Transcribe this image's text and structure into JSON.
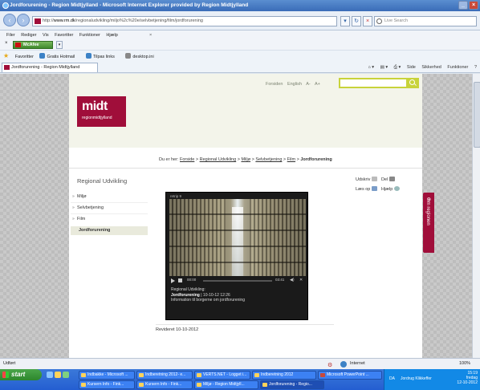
{
  "window": {
    "title": "Jordforurening - Region Midtjylland - Microsoft Internet Explorer provided by Region Midtjylland"
  },
  "addressbar": {
    "url_prefix": "http://",
    "url_domain": "www.rm.dk",
    "url_path": "/regionaludvikling/miljo%2c%20e/selvbetjening/film/jordforurening",
    "search_placeholder": "Live Search"
  },
  "menubar": {
    "items": [
      "Filer",
      "Rediger",
      "Vis",
      "Favoritter",
      "Funktioner",
      "Hjælp"
    ]
  },
  "mcafee": {
    "label": "McAfee"
  },
  "favorites": {
    "label": "Favoritter",
    "items": [
      "Gratis Hotmail",
      "Tilpas links",
      "desktop.ini"
    ]
  },
  "tab": {
    "label": "Jordforurening - Region Midtjylland"
  },
  "commandbar": {
    "items": [
      "Side",
      "Sikkerhed",
      "Funktioner"
    ]
  },
  "site": {
    "util_links": [
      "Forsiden",
      "English",
      "A-",
      "A+"
    ],
    "logo_big": "midt",
    "logo_small": "regionmidtjylland",
    "breadcrumb": {
      "prefix": "Du er her:",
      "items": [
        "Forside",
        "Regional Udvikling",
        "Miljø",
        "Selvbetjening",
        "Film"
      ],
      "current": "Jordforurening",
      "separator": ">"
    },
    "nav": {
      "title": "Regional Udvikling",
      "items": [
        "Miljø",
        "Selvbetjening",
        "Film"
      ],
      "active": "Jordforurening"
    },
    "tools": {
      "print": "Udskriv",
      "send": "Del",
      "read": "Læs op",
      "help": "Hjælp"
    },
    "video": {
      "tag": "retrip 9",
      "time_current": "00:00",
      "time_total": "03:41",
      "info_line1": "Regional Udvikling:",
      "info_title": "Jordforurening",
      "info_date": "| 10-10-12 12:26",
      "info_line3": "Information til borgerne om jordforurening"
    },
    "revised": "Revideret 10-10-2012",
    "side_tab": "Om regionen"
  },
  "statusbar": {
    "left": "Udført",
    "zone": "Internet",
    "zoom": "100%"
  },
  "taskbar": {
    "start": "start",
    "buttons_row1": [
      "Indbakke - Microsoft ...",
      "Indberetning 2012- e...",
      "VERTS.NET - Logget i...",
      "Indberetning 2012",
      "Microsoft PowerPoint ..."
    ],
    "buttons_row2": [
      "Kursern Info - Fink...",
      "Kursern Info - Fink...",
      "Miljø - Region Midtjyll...",
      "Jordforurening - Regio..."
    ],
    "tray_lang": "DA",
    "tray_name": "Jordrug Klikkeffer",
    "clock_time": "15:19",
    "clock_day": "fredag",
    "clock_date": "12-10-2012"
  },
  "colors": {
    "brand": "#a00e3a",
    "search_accent": "#c8d33a",
    "ie_title": "#3a6cb8"
  }
}
